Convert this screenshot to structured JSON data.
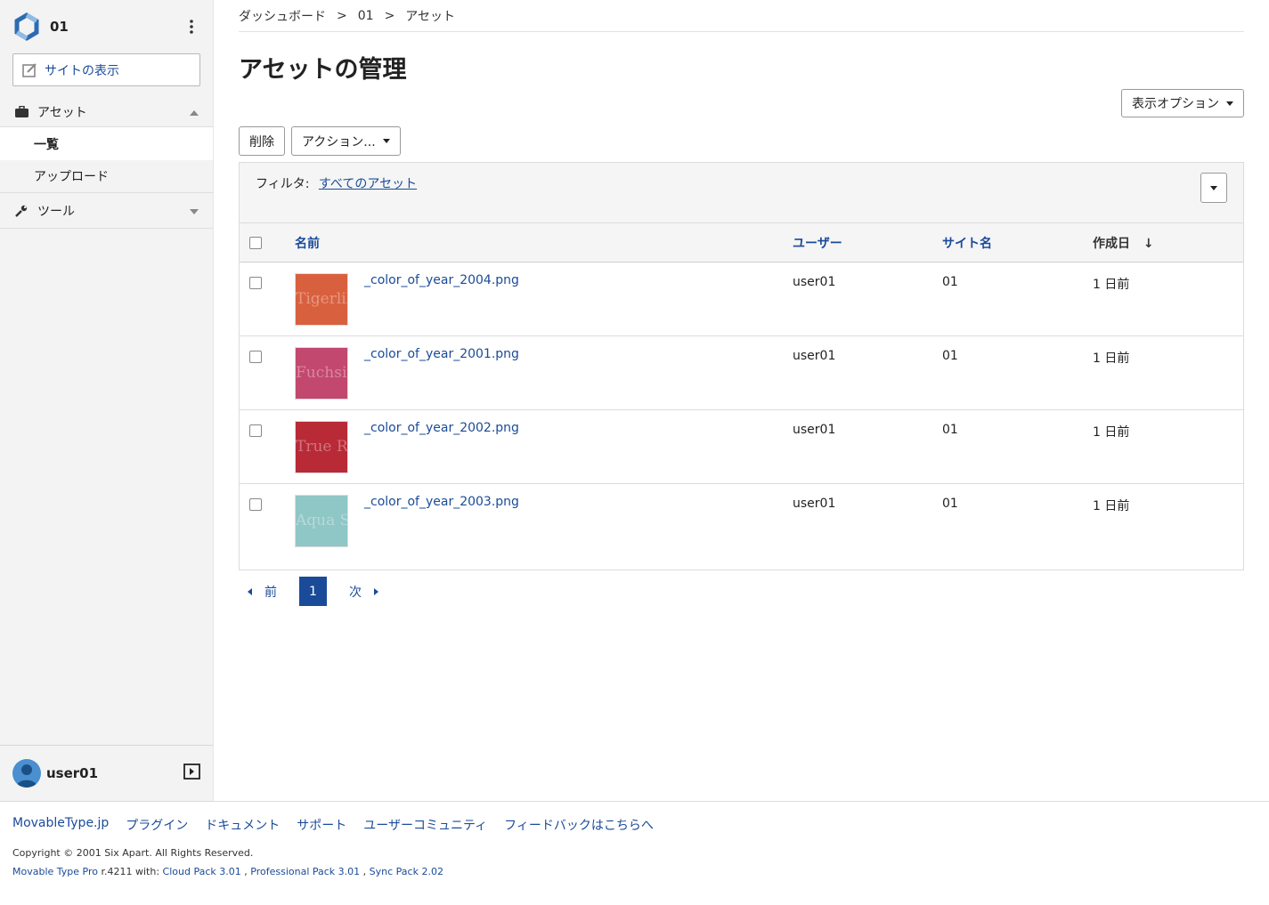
{
  "site": {
    "name": "01",
    "view_site_label": "サイトの表示"
  },
  "sidebar": {
    "assets_label": "アセット",
    "list_label": "一覧",
    "upload_label": "アップロード",
    "tools_label": "ツール"
  },
  "user": {
    "name": "user01"
  },
  "breadcrumb": [
    "ダッシュボード",
    "01",
    "アセット"
  ],
  "breadcrumb_sep": ">",
  "page_title": "アセットの管理",
  "display_options_label": "表示オプション",
  "delete_label": "削除",
  "actions_label": "アクション...",
  "filter": {
    "label": "フィルタ:",
    "value": "すべてのアセット"
  },
  "table": {
    "headers": {
      "name": "名前",
      "user": "ユーザー",
      "site": "サイト名",
      "date": "作成日"
    },
    "sort_indicator": "↓",
    "rows": [
      {
        "thumb_color": "#d9603e",
        "thumb_text": "Tigerlily",
        "filename": "_color_of_year_2004.png",
        "user": "user01",
        "site": "01",
        "date": "1 日前"
      },
      {
        "thumb_color": "#c2486f",
        "thumb_text": "Fuchsia Rose",
        "filename": "_color_of_year_2001.png",
        "user": "user01",
        "site": "01",
        "date": "1 日前"
      },
      {
        "thumb_color": "#b82a36",
        "thumb_text": "True Red",
        "filename": "_color_of_year_2002.png",
        "user": "user01",
        "site": "01",
        "date": "1 日前"
      },
      {
        "thumb_color": "#8fc6c6",
        "thumb_text": "Aqua Sky",
        "filename": "_color_of_year_2003.png",
        "user": "user01",
        "site": "01",
        "date": "1 日前"
      }
    ]
  },
  "pager": {
    "prev": "前",
    "current": "1",
    "next": "次"
  },
  "footer": {
    "links": [
      "MovableType.jp",
      "プラグイン",
      "ドキュメント",
      "サポート",
      "ユーザーコミュニティ",
      "フィードバックはこちらへ"
    ],
    "copyright": "Copyright © 2001 Six Apart. All Rights Reserved.",
    "version_product": "Movable Type Pro",
    "version_rest": " r.4211 with: ",
    "packs": [
      "Cloud Pack 3.01",
      "Professional Pack 3.01",
      "Sync Pack 2.02"
    ],
    "pack_sep": " , "
  },
  "colors": {
    "accent": "#1a4b99",
    "sidebar_bg": "#f3f3f3"
  }
}
